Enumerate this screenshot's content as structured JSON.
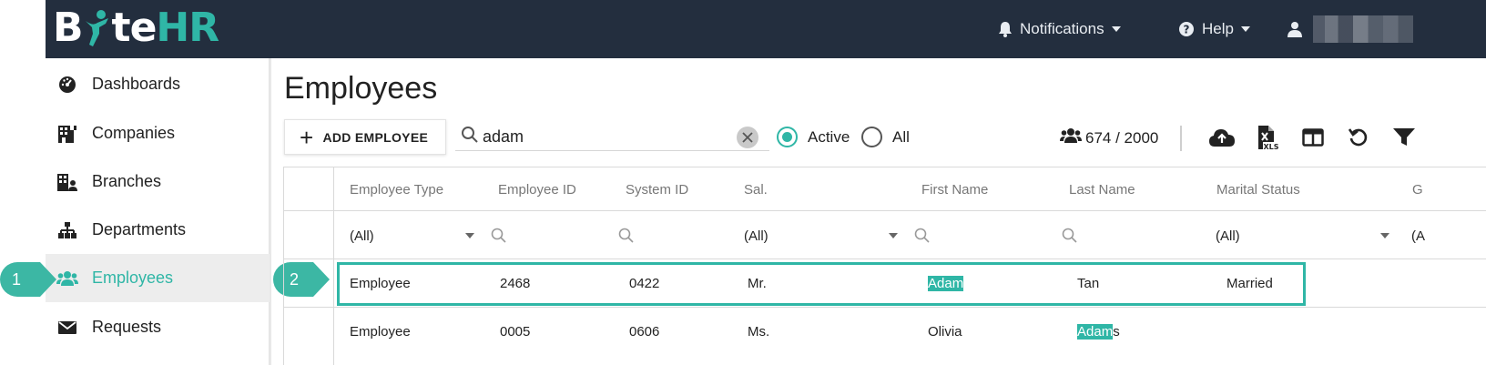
{
  "app": {
    "logo": {
      "part1": "B",
      "part2": "te",
      "part3": "HR"
    }
  },
  "topbar": {
    "notifications_label": "Notifications",
    "help_label": "Help"
  },
  "sidebar": {
    "items": [
      {
        "label": "Dashboards",
        "icon": "dashboard-gauge-icon"
      },
      {
        "label": "Companies",
        "icon": "building-icon"
      },
      {
        "label": "Branches",
        "icon": "branch-building-icon"
      },
      {
        "label": "Departments",
        "icon": "org-chart-icon"
      },
      {
        "label": "Employees",
        "icon": "users-icon",
        "active": true
      },
      {
        "label": "Requests",
        "icon": "envelope-icon"
      }
    ]
  },
  "callouts": [
    {
      "number": "1"
    },
    {
      "number": "2"
    }
  ],
  "page": {
    "title": "Employees",
    "add_button_label": "ADD EMPLOYEE",
    "search_value": "adam",
    "status_filter": {
      "options": [
        "Active",
        "All"
      ],
      "selected": "Active"
    },
    "count_text": "674 / 2000"
  },
  "grid": {
    "columns": [
      "Employee Type",
      "Employee ID",
      "System ID",
      "Sal.",
      "First Name",
      "Last Name",
      "Marital Status",
      "G"
    ],
    "filters": {
      "employee_type": "(All)",
      "salutation": "(All)",
      "marital_status": "(All)",
      "last_column": "(A"
    },
    "rows": [
      {
        "employee_type": "Employee",
        "employee_id": "2468",
        "system_id": "0422",
        "salutation": "Mr.",
        "first_name": "Adam",
        "last_name": "Tan",
        "marital_status": "Married",
        "highlighted": true
      },
      {
        "employee_type": "Employee",
        "employee_id": "0005",
        "system_id": "0606",
        "salutation": "Ms.",
        "first_name": "Olivia",
        "last_name_match": "Adam",
        "last_name_rest": "s",
        "marital_status": ""
      }
    ]
  },
  "colors": {
    "accent": "#2fb6a6",
    "topbar": "#232e3e",
    "active_item_bg": "#ededed"
  }
}
